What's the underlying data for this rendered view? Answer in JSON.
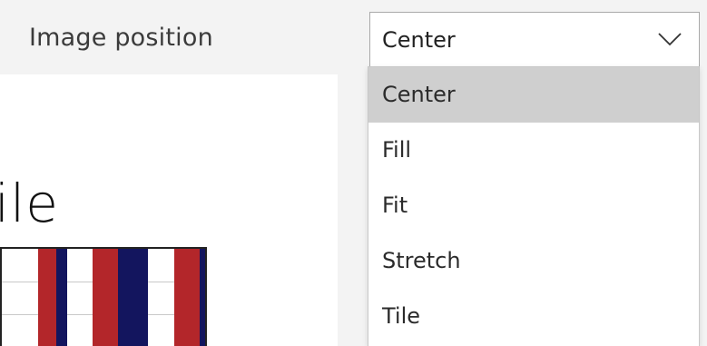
{
  "setting": {
    "label": "Image position",
    "selected_value": "Center"
  },
  "dropdown": {
    "options": [
      {
        "label": "Center",
        "selected": true
      },
      {
        "label": "Fill",
        "selected": false
      },
      {
        "label": "Fit",
        "selected": false
      },
      {
        "label": "Stretch",
        "selected": false
      },
      {
        "label": "Tile",
        "selected": false
      }
    ]
  },
  "preview": {
    "title_fragment": "ile",
    "colors": {
      "red": "#b3262a",
      "navy": "#13155e",
      "white": "#ffffff"
    }
  },
  "colors": {
    "row_background": "#f3f3f3",
    "selected_option_background": "#cfcfcf",
    "border": "#a9a9a9"
  },
  "icons": {
    "dropdown_chevron": "chevron-down-icon"
  }
}
